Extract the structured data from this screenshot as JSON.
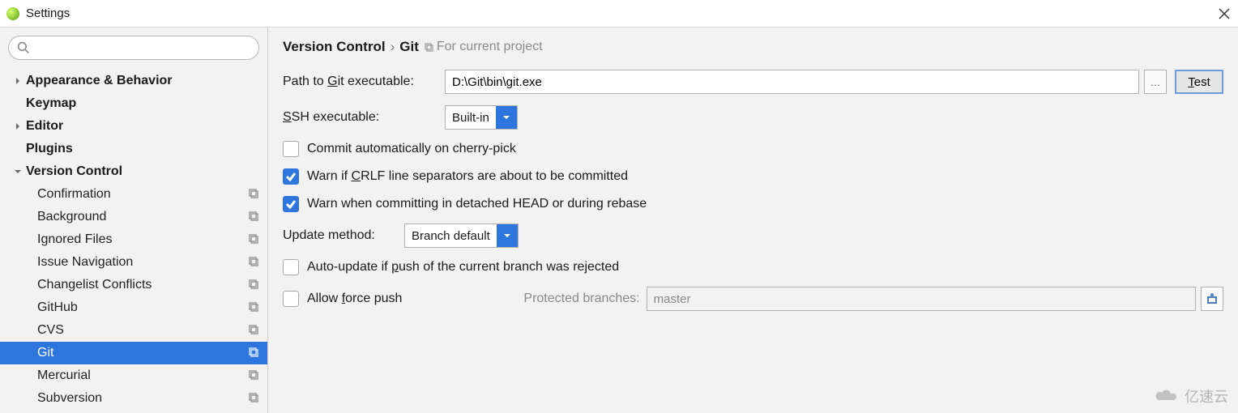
{
  "window": {
    "title": "Settings"
  },
  "sidebar": {
    "search_placeholder": "",
    "items": [
      {
        "label": "Appearance & Behavior",
        "type": "top",
        "arrow": "right"
      },
      {
        "label": "Keymap",
        "type": "top",
        "arrow": "none"
      },
      {
        "label": "Editor",
        "type": "top",
        "arrow": "right"
      },
      {
        "label": "Plugins",
        "type": "top",
        "arrow": "none"
      },
      {
        "label": "Version Control",
        "type": "top",
        "arrow": "down"
      },
      {
        "label": "Confirmation",
        "type": "sub",
        "badge": true
      },
      {
        "label": "Background",
        "type": "sub",
        "badge": true
      },
      {
        "label": "Ignored Files",
        "type": "sub",
        "badge": true
      },
      {
        "label": "Issue Navigation",
        "type": "sub",
        "badge": true
      },
      {
        "label": "Changelist Conflicts",
        "type": "sub",
        "badge": true
      },
      {
        "label": "GitHub",
        "type": "sub",
        "badge": true
      },
      {
        "label": "CVS",
        "type": "sub",
        "badge": true
      },
      {
        "label": "Git",
        "type": "sub",
        "badge": true,
        "selected": true
      },
      {
        "label": "Mercurial",
        "type": "sub",
        "badge": true
      },
      {
        "label": "Subversion",
        "type": "sub",
        "badge": true
      }
    ]
  },
  "breadcrumb": {
    "part1": "Version Control",
    "sep": "›",
    "part2": "Git",
    "hint": "For current project"
  },
  "form": {
    "path_label_pre": "Path to ",
    "path_label_u": "G",
    "path_label_post": "it executable:",
    "path_value": "D:\\Git\\bin\\git.exe",
    "test_label_u": "T",
    "test_label_post": "est",
    "ssh_label_u": "S",
    "ssh_label_post": "SH executable:",
    "ssh_value": "Built-in",
    "chk_commit": "Commit automatically on cherry-pick",
    "chk_crlf_pre": "Warn if ",
    "chk_crlf_u": "C",
    "chk_crlf_post": "RLF line separators are about to be committed",
    "chk_detached": "Warn when committing in detached HEAD or during rebase",
    "update_label": "Update method:",
    "update_value": "Branch default",
    "chk_push_pre": "Auto-update if ",
    "chk_push_u": "p",
    "chk_push_post": "ush of the current branch was rejected",
    "chk_force_pre": "Allow ",
    "chk_force_u": "f",
    "chk_force_post": "orce push",
    "protected_label": "Protected branches:",
    "protected_value": "master"
  },
  "watermark": "亿速云"
}
